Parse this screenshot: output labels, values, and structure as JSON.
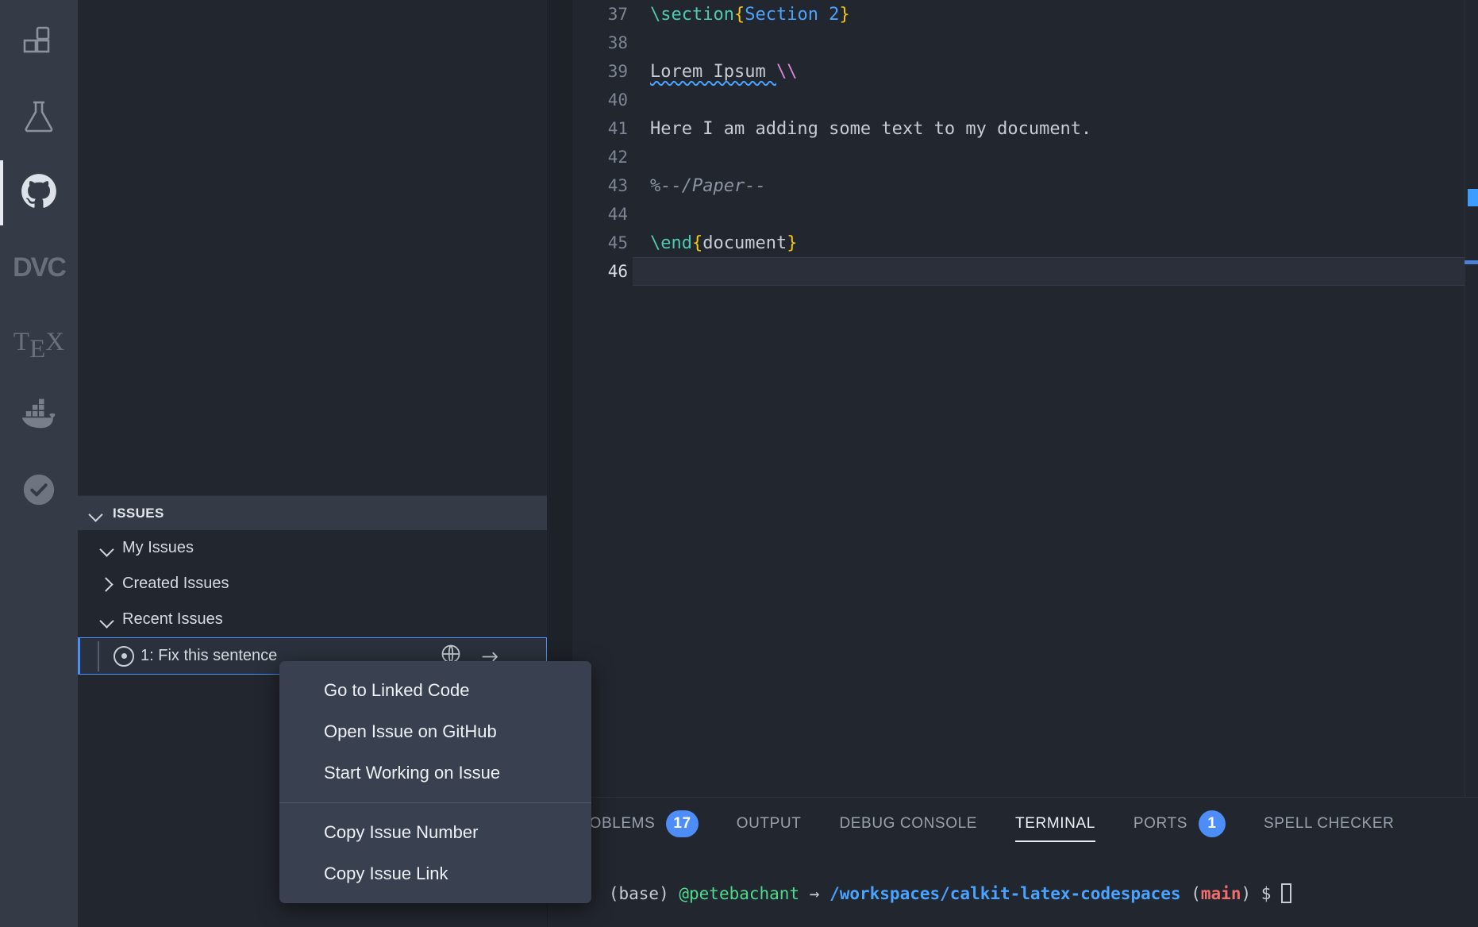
{
  "activity_bar": {
    "items": [
      {
        "name": "extensions-icon",
        "label": "Extensions",
        "active": false
      },
      {
        "name": "testing-flask-icon",
        "label": "Testing",
        "active": false
      },
      {
        "name": "github-icon",
        "label": "GitHub",
        "active": true
      },
      {
        "name": "dvc-icon",
        "label": "DVC",
        "active": false
      },
      {
        "name": "tex-icon",
        "label": "TeX",
        "active": false
      },
      {
        "name": "docker-icon",
        "label": "Docker",
        "active": false
      },
      {
        "name": "check-circle-icon",
        "label": "Checks",
        "active": false
      }
    ],
    "tex_text": "TEX",
    "dvc_text": "DVC"
  },
  "sidebar": {
    "section": {
      "title": "ISSUES",
      "expanded": true
    },
    "tree": [
      {
        "label": "My Issues",
        "expanded": true,
        "type": "group"
      },
      {
        "label": "Created Issues",
        "expanded": false,
        "type": "group"
      },
      {
        "label": "Recent Issues",
        "expanded": true,
        "type": "group"
      },
      {
        "label": "1: Fix this sentence",
        "type": "issue",
        "selected": true,
        "actions": [
          "globe-icon",
          "arrow-right-icon"
        ]
      }
    ]
  },
  "editor": {
    "lines": [
      {
        "num": "37",
        "tokens": [
          {
            "t": "\\section",
            "c": "tk-cmd"
          },
          {
            "t": "{",
            "c": "tk-brace"
          },
          {
            "t": "Section 2",
            "c": "tk-arg"
          },
          {
            "t": "}",
            "c": "tk-brace"
          }
        ]
      },
      {
        "num": "38",
        "tokens": []
      },
      {
        "num": "39",
        "tokens": [
          {
            "t": "Lorem Ipsum ",
            "c": "tk-plain spell"
          },
          {
            "t": "\\\\",
            "c": "tk-esc"
          }
        ]
      },
      {
        "num": "40",
        "tokens": []
      },
      {
        "num": "41",
        "tokens": [
          {
            "t": "Here I am adding some text to my document.",
            "c": "tk-plain"
          }
        ]
      },
      {
        "num": "42",
        "tokens": []
      },
      {
        "num": "43",
        "tokens": [
          {
            "t": "%--/Paper--",
            "c": "tk-comment"
          }
        ]
      },
      {
        "num": "44",
        "tokens": []
      },
      {
        "num": "45",
        "tokens": [
          {
            "t": "\\end",
            "c": "tk-cmd"
          },
          {
            "t": "{",
            "c": "tk-brace"
          },
          {
            "t": "document",
            "c": "tk-plain"
          },
          {
            "t": "}",
            "c": "tk-brace"
          }
        ]
      },
      {
        "num": "46",
        "tokens": [],
        "active": true
      }
    ]
  },
  "panel": {
    "tabs": [
      {
        "label": "PROBLEMS",
        "badge": "17",
        "active": false
      },
      {
        "label": "OUTPUT",
        "badge": null,
        "active": false
      },
      {
        "label": "DEBUG CONSOLE",
        "badge": null,
        "active": false
      },
      {
        "label": "TERMINAL",
        "badge": null,
        "active": true
      },
      {
        "label": "PORTS",
        "badge": "1",
        "active": false
      },
      {
        "label": "SPELL CHECKER",
        "badge": null,
        "active": false
      }
    ],
    "terminal": {
      "env": "(base)",
      "user": "@petebachant",
      "arrow": "→",
      "path": "/workspaces/calkit-latex-codespaces",
      "branch_open": "(",
      "branch": "main",
      "branch_close": ")",
      "prompt": "$"
    }
  },
  "context_menu": {
    "items": [
      {
        "label": "Go to Linked Code",
        "separator_after": false
      },
      {
        "label": "Open Issue on GitHub",
        "separator_after": false
      },
      {
        "label": "Start Working on Issue",
        "separator_after": true
      },
      {
        "label": "Copy Issue Number",
        "separator_after": false
      },
      {
        "label": "Copy Issue Link",
        "separator_after": false
      }
    ]
  },
  "colors": {
    "accent_blue": "#4c8df7",
    "activity_bar_bg": "#343a46",
    "sidebar_bg": "#22262e",
    "editor_bg": "#22262e",
    "menu_bg": "#394150",
    "latex_command": "#4ec9b0",
    "latex_brace": "#f2c60c",
    "latex_arg": "#4aa3ff",
    "latex_escape": "#d886d8",
    "comment": "#8d94a3",
    "terminal_user": "#4ddb8f",
    "terminal_branch": "#f26d6d"
  }
}
